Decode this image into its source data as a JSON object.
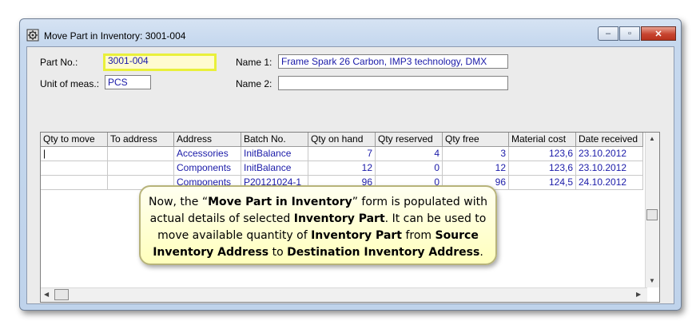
{
  "window": {
    "title": "Move Part in Inventory: 3001-004",
    "app_icon": "gear-cube-icon",
    "buttons": {
      "minimize": "minimize-icon",
      "maximize": "maximize-icon",
      "close": "close-icon"
    }
  },
  "form": {
    "part_no_label": "Part No.:",
    "part_no_value": "3001-004",
    "unit_label": "Unit of meas.:",
    "unit_value": "PCS",
    "name1_label": "Name 1:",
    "name1_value": "Frame Spark 26 Carbon, IMP3 technology, DMX",
    "name2_label": "Name 2:",
    "name2_value": ""
  },
  "grid": {
    "columns": [
      "Qty to move",
      "To address",
      "Address",
      "Batch No.",
      "Qty on hand",
      "Qty reserved",
      "Qty free",
      "Material cost",
      "Date received"
    ],
    "rows": [
      {
        "qty_to_move": "|",
        "to_address": "",
        "address": "Accessories",
        "batch_no": "InitBalance",
        "qty_on_hand": "7",
        "qty_reserved": "4",
        "qty_free": "3",
        "material_cost": "123,6",
        "date_received": "23.10.2012"
      },
      {
        "qty_to_move": "",
        "to_address": "",
        "address": "Components",
        "batch_no": "InitBalance",
        "qty_on_hand": "12",
        "qty_reserved": "0",
        "qty_free": "12",
        "material_cost": "123,6",
        "date_received": "23.10.2012"
      },
      {
        "qty_to_move": "",
        "to_address": "",
        "address": "Components",
        "batch_no": "P20121024-1",
        "qty_on_hand": "96",
        "qty_reserved": "0",
        "qty_free": "96",
        "material_cost": "124,5",
        "date_received": "24.10.2012"
      }
    ]
  },
  "callout": {
    "t1": "Now, the “",
    "t2": "Move Part in Inventory",
    "t3": "” form is populated with actual details of selected ",
    "t4": "Inventory Part",
    "t5": ".  It can be used to move available quantity of ",
    "t6": "Inventory Part",
    "t7": " from ",
    "t8": "Source Inventory Address",
    "t9": " to ",
    "t10": "Destination Inventory Address",
    "t11": "."
  },
  "colors": {
    "value_text": "#1a1aa8",
    "focus_highlight": "#e9f03a",
    "callout_bg": "#ffffbc"
  }
}
